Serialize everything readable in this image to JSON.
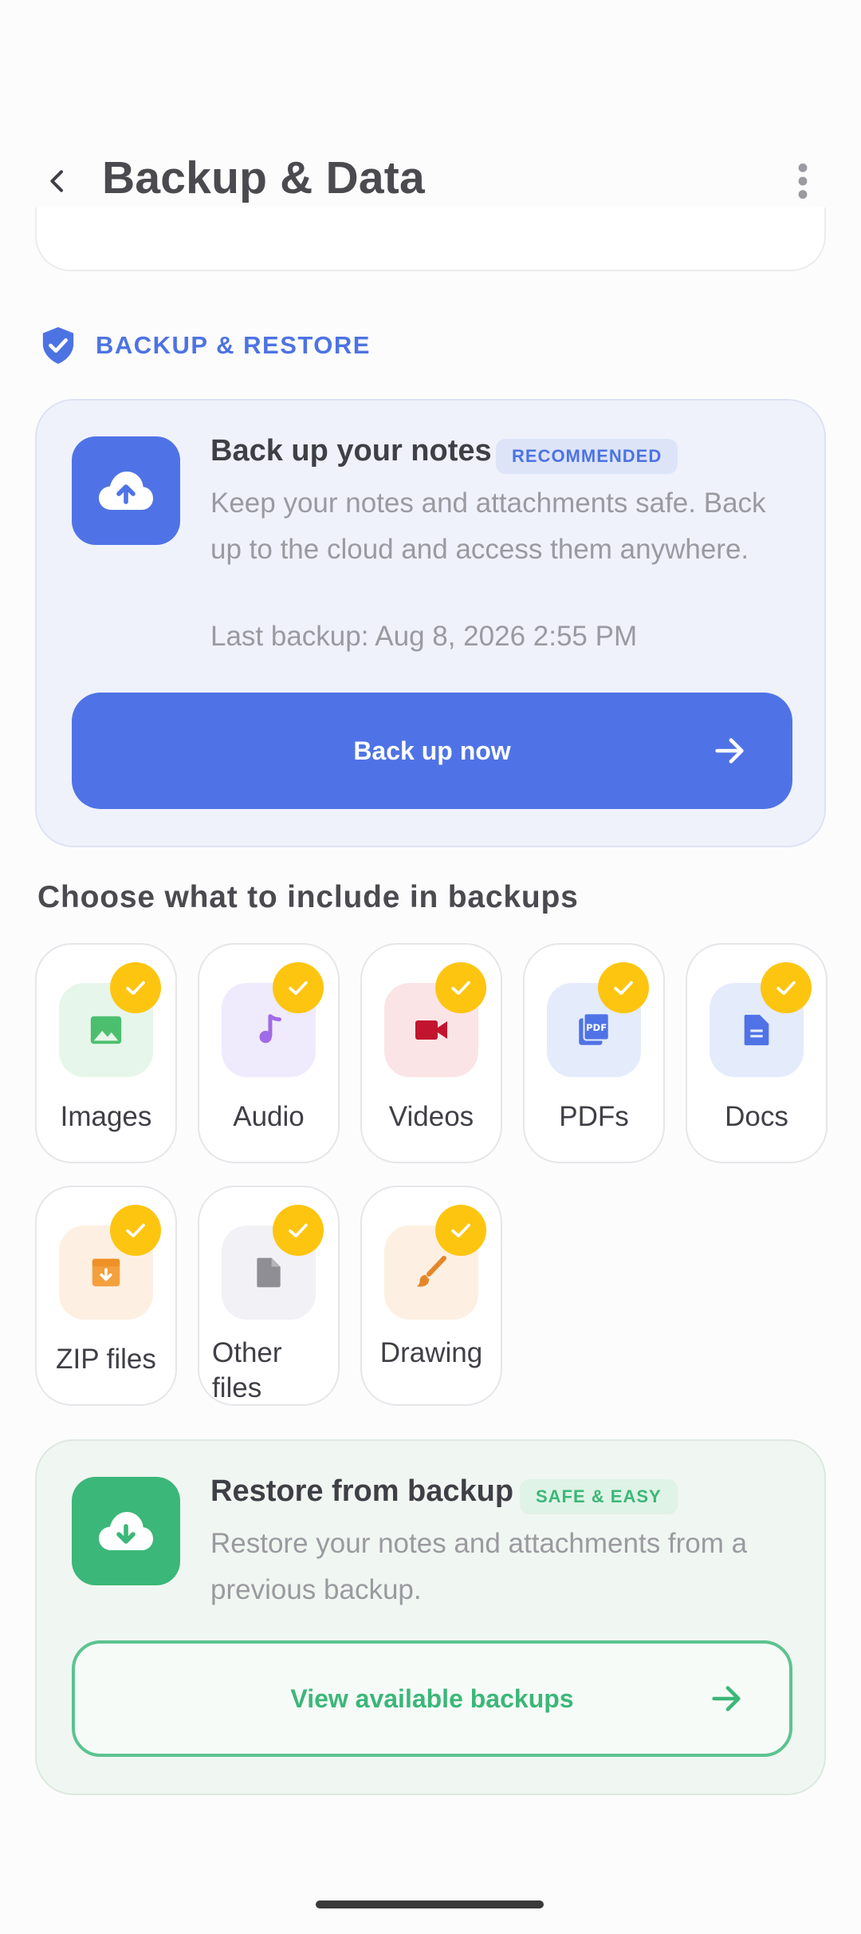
{
  "appbar": {
    "title": "Backup & Data"
  },
  "section": {
    "label": "BACKUP & RESTORE"
  },
  "backup_card": {
    "title": "Back up your notes",
    "badge": "RECOMMENDED",
    "description": "Keep your notes and attachments safe. Back up to the cloud and access them anywhere.",
    "last_backup": "Last backup: Aug 8, 2026 2:55 PM",
    "button_label": "Back up now"
  },
  "include": {
    "title": "Choose what to include in backups",
    "items": [
      {
        "label": "Images",
        "icon": "image-icon",
        "checked": true
      },
      {
        "label": "Audio",
        "icon": "music-note-icon",
        "checked": true
      },
      {
        "label": "Videos",
        "icon": "video-camera-icon",
        "checked": true
      },
      {
        "label": "PDFs",
        "icon": "pdf-icon",
        "checked": true
      },
      {
        "label": "Docs",
        "icon": "document-icon",
        "checked": true
      },
      {
        "label": "ZIP files",
        "icon": "archive-icon",
        "checked": true
      },
      {
        "label": "Other files",
        "icon": "file-icon",
        "checked": true
      },
      {
        "label": "Drawing",
        "icon": "brush-icon",
        "checked": true
      }
    ]
  },
  "restore_card": {
    "title": "Restore from backup",
    "badge": "SAFE & EASY",
    "description": "Restore your notes and attachments from a previous backup.",
    "button_label": "View available backups"
  },
  "colors": {
    "primary": "#4f73e6",
    "success": "#3bb779",
    "check": "#fdc510"
  }
}
